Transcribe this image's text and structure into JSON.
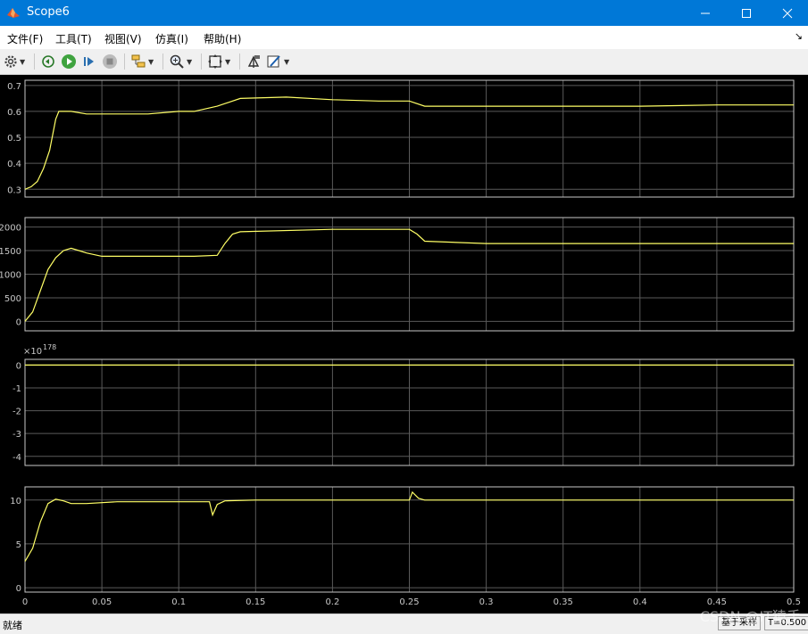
{
  "window": {
    "title": "Scope6"
  },
  "menu": [
    "文件(F)",
    "工具(T)",
    "视图(V)",
    "仿真(I)",
    "帮助(H)"
  ],
  "toolbar": {
    "icons": [
      "settings-icon",
      "restore-view-icon",
      "run-icon",
      "step-forward-icon",
      "stop-icon",
      "highlight-block-icon",
      "zoom-icon",
      "autoscale-icon",
      "write-data-icon",
      "style-icon"
    ]
  },
  "colors": {
    "trace": "#ffff66",
    "grid": "#5a5a5a",
    "axis": "#c8c8c8",
    "plot_bg": "#000000"
  },
  "chart_data": [
    {
      "type": "line",
      "xlim": [
        0,
        0.5
      ],
      "ylim": [
        0.27,
        0.72
      ],
      "yticks": [
        "0.3",
        "0.4",
        "0.5",
        "0.6",
        "0.7"
      ],
      "ytick_values": [
        0.3,
        0.4,
        0.5,
        0.6,
        0.7
      ],
      "series": [
        {
          "x": [
            0,
            0.004,
            0.008,
            0.012,
            0.016,
            0.02,
            0.022,
            0.03,
            0.04,
            0.06,
            0.08,
            0.1,
            0.11,
            0.125,
            0.14,
            0.17,
            0.2,
            0.23,
            0.25,
            0.26,
            0.3,
            0.35,
            0.4,
            0.45,
            0.5
          ],
          "y": [
            0.3,
            0.31,
            0.33,
            0.38,
            0.45,
            0.57,
            0.6,
            0.6,
            0.59,
            0.59,
            0.59,
            0.6,
            0.6,
            0.62,
            0.65,
            0.655,
            0.645,
            0.64,
            0.64,
            0.62,
            0.62,
            0.62,
            0.62,
            0.625,
            0.625
          ]
        }
      ]
    },
    {
      "type": "line",
      "xlim": [
        0,
        0.5
      ],
      "ylim": [
        -200,
        2200
      ],
      "yticks": [
        "0",
        "500",
        "1000",
        "1500",
        "2000"
      ],
      "ytick_values": [
        0,
        500,
        1000,
        1500,
        2000
      ],
      "series": [
        {
          "x": [
            0,
            0.005,
            0.01,
            0.015,
            0.02,
            0.025,
            0.03,
            0.035,
            0.04,
            0.05,
            0.1,
            0.11,
            0.125,
            0.13,
            0.135,
            0.14,
            0.2,
            0.25,
            0.255,
            0.26,
            0.3,
            0.4,
            0.5
          ],
          "y": [
            0,
            200,
            650,
            1100,
            1350,
            1500,
            1550,
            1500,
            1450,
            1380,
            1380,
            1380,
            1400,
            1650,
            1850,
            1900,
            1950,
            1950,
            1850,
            1700,
            1650,
            1650,
            1650
          ]
        }
      ]
    },
    {
      "type": "line",
      "xlim": [
        0,
        0.5
      ],
      "ylim": [
        -4.4,
        0.25
      ],
      "exponent_label": "×10",
      "exponent": "178",
      "yticks": [
        "0",
        "-1",
        "-2",
        "-3",
        "-4"
      ],
      "ytick_values": [
        0,
        -1,
        -2,
        -3,
        -4
      ],
      "series": [
        {
          "x": [
            0,
            0.5
          ],
          "y": [
            0,
            0
          ]
        }
      ]
    },
    {
      "type": "line",
      "xlim": [
        0,
        0.5
      ],
      "ylim": [
        -0.5,
        11.5
      ],
      "yticks": [
        "0",
        "5",
        "10"
      ],
      "ytick_values": [
        0,
        5,
        10
      ],
      "xticks": [
        "0",
        "0.05",
        "0.1",
        "0.15",
        "0.2",
        "0.25",
        "0.3",
        "0.35",
        "0.4",
        "0.45",
        "0.5"
      ],
      "xtick_values": [
        0,
        0.05,
        0.1,
        0.15,
        0.2,
        0.25,
        0.3,
        0.35,
        0.4,
        0.45,
        0.5
      ],
      "series": [
        {
          "x": [
            0,
            0.005,
            0.01,
            0.015,
            0.02,
            0.025,
            0.03,
            0.04,
            0.06,
            0.1,
            0.12,
            0.122,
            0.125,
            0.13,
            0.15,
            0.2,
            0.25,
            0.252,
            0.256,
            0.26,
            0.3,
            0.4,
            0.5
          ],
          "y": [
            3,
            4.5,
            7.5,
            9.6,
            10.1,
            9.9,
            9.6,
            9.6,
            9.8,
            9.8,
            9.8,
            8.3,
            9.5,
            9.9,
            10,
            10,
            10,
            10.9,
            10.2,
            10,
            10,
            10,
            10
          ]
        }
      ]
    }
  ],
  "status": {
    "left": "就绪",
    "sample": "基于采样",
    "time": "T=0.500"
  },
  "watermark": "CSDN @IT猿手"
}
